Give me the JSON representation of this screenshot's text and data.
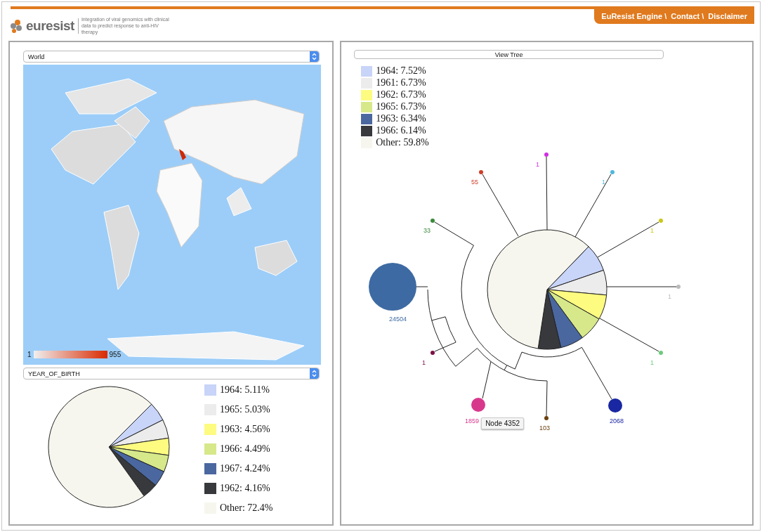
{
  "header": {
    "logo": "euresist",
    "tagline": "Integration of viral genomics with clinical data to predict response to anti-HIV therapy",
    "nav": [
      "EuResist Engine \\",
      "Contact \\",
      "Disclaimer"
    ]
  },
  "map_panel": {
    "region_select": "World",
    "scale_min": "1",
    "scale_max": "955",
    "attribute_select": "YEAR_OF_BIRTH",
    "legend": [
      {
        "label": "1964: 5.11%",
        "color": "#c8d4f8"
      },
      {
        "label": "1965: 5.03%",
        "color": "#ececec"
      },
      {
        "label": "1963: 4.56%",
        "color": "#fdfb80"
      },
      {
        "label": "1966: 4.49%",
        "color": "#d6e88a"
      },
      {
        "label": "1967: 4.24%",
        "color": "#4a67a0"
      },
      {
        "label": "1962: 4.16%",
        "color": "#38393d"
      },
      {
        "label": "Other: 72.4%",
        "color": "#f6f6ee"
      }
    ],
    "chart_data": {
      "type": "pie",
      "values": [
        5.11,
        5.03,
        4.56,
        4.49,
        4.24,
        4.16,
        72.4
      ]
    }
  },
  "tree_panel": {
    "button": "View Tree",
    "legend": [
      {
        "label": "1964: 7.52%",
        "color": "#c8d4f8"
      },
      {
        "label": "1961: 6.73%",
        "color": "#ececec"
      },
      {
        "label": "1962: 6.73%",
        "color": "#fdfb80"
      },
      {
        "label": "1965: 6.73%",
        "color": "#d6e88a"
      },
      {
        "label": "1963: 6.34%",
        "color": "#4a67a0"
      },
      {
        "label": "1966: 6.14%",
        "color": "#38393d"
      },
      {
        "label": "Other: 59.8%",
        "color": "#f6f6ee"
      }
    ],
    "chart_data": {
      "type": "pie",
      "values": [
        7.52,
        6.73,
        6.73,
        6.73,
        6.34,
        6.14,
        59.8
      ]
    },
    "nodes": [
      {
        "label": "1",
        "color": "#d22ee4"
      },
      {
        "label": "55",
        "color": "#cf3f2a"
      },
      {
        "label": "1",
        "color": "#4fb8dc"
      },
      {
        "label": "1",
        "color": "#c8c818"
      },
      {
        "label": "1",
        "color": "#bbbbbb"
      },
      {
        "label": "1",
        "color": "#6ccc7c"
      },
      {
        "label": "2068",
        "color": "#1a27a2"
      },
      {
        "label": "103",
        "color": "#6b4010"
      },
      {
        "label": "1859",
        "color": "#d8388c"
      },
      {
        "label": "1",
        "color": "#7c1046"
      },
      {
        "label": "24504",
        "color": "#3d6aa2"
      },
      {
        "label": "33",
        "color": "#3a8a3a"
      }
    ],
    "tooltip": "Node 4352"
  }
}
